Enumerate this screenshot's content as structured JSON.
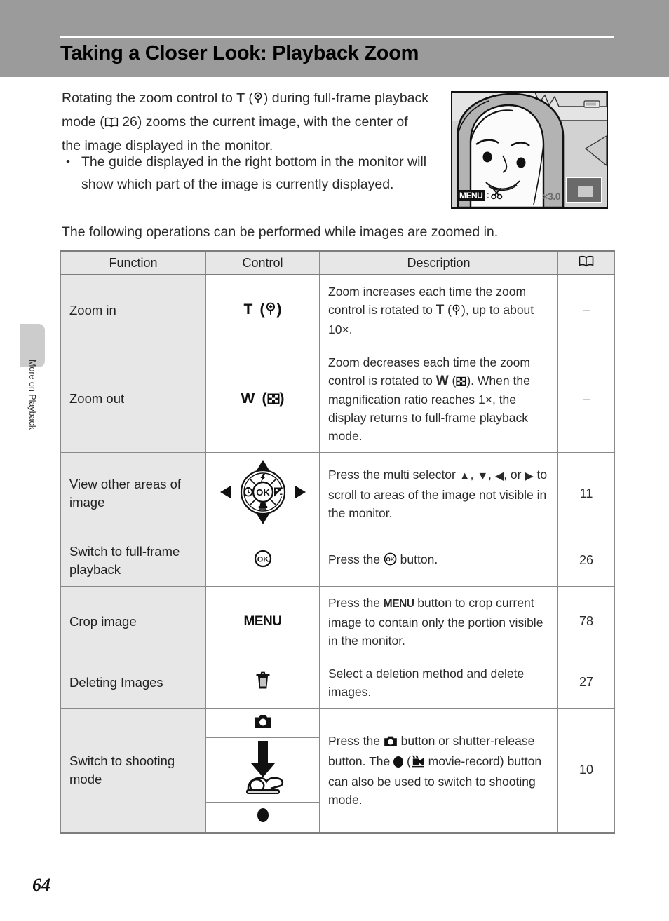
{
  "header": {
    "title": "Taking a Closer Look: Playback Zoom",
    "band_color": "#9b9b9b"
  },
  "side_tab": {
    "label": "More on Playback",
    "block_color": "#cccccc"
  },
  "body": {
    "intro_part1": "Rotating the zoom control to ",
    "intro_T": "T",
    "intro_part2": ") during full-frame playback mode (",
    "intro_page_ref": "26",
    "intro_part3": ") zooms the current image, with the center of the image displayed in the monitor.",
    "bullet1": "The guide displayed in the right bottom in the monitor will show which part of the image is currently displayed.",
    "lead_in": "The following operations can be performed while images are zoomed in."
  },
  "monitor": {
    "menu_label": "MENU",
    "crop_icon": "scissors-icon",
    "magnification": "3.0",
    "magnification_prefix": "×",
    "guide_box": "zoom-guide-indicator",
    "battery_icon": "battery-icon"
  },
  "table": {
    "headers": {
      "function": "Function",
      "control": "Control",
      "description": "Description",
      "page": "book-icon"
    },
    "rows": [
      {
        "function": "Zoom in",
        "control_type": "T-zoom",
        "control_letter": "T",
        "control_icon": "magnify-plus-icon",
        "desc_a": "Zoom increases each time the zoom control is rotated to ",
        "desc_T": "T",
        "desc_b": "), up to about 10",
        "desc_c": ".",
        "page": "–"
      },
      {
        "function": "Zoom out",
        "control_type": "W-zoom",
        "control_letter": "W",
        "control_icon": "thumbnail-grid-icon",
        "desc_a": "Zoom decreases each time the zoom control is rotated to ",
        "desc_W": "W",
        "desc_b": "). When the magnification ratio reaches 1",
        "desc_c": ", the display returns to full-frame playback mode.",
        "page": "–"
      },
      {
        "function": "View other areas of image",
        "control_type": "multi-selector",
        "control_icon": "multi-selector-dial-icon",
        "desc_a": "Press the multi selector ",
        "desc_b": ", ",
        "desc_c": ", ",
        "desc_d": ", or ",
        "desc_e": " to scroll to areas of the image not visible in the monitor.",
        "page": "11"
      },
      {
        "function": "Switch to full-frame playback",
        "control_type": "ok-button",
        "control_icon": "ok-button-icon",
        "desc_a": "Press the ",
        "desc_b": " button.",
        "page": "26"
      },
      {
        "function": "Crop image",
        "control_type": "menu-button",
        "control_label": "MENU",
        "desc_a": "Press the ",
        "desc_menu": "MENU",
        "desc_b": " button to crop current image to contain only the portion visible in the monitor.",
        "page": "78"
      },
      {
        "function": "Deleting Images",
        "control_type": "delete-button",
        "control_icon": "trash-icon",
        "desc_a": "Select a deletion method and delete images.",
        "page": "27"
      },
      {
        "function": "Switch to shooting mode",
        "control_type": "shooting-group",
        "control_icons": [
          "camera-icon",
          "shutter-press-icon",
          "movie-record-dot-icon"
        ],
        "desc_a": "Press the ",
        "desc_b": " button or shutter-release button. The ",
        "desc_c": " (",
        "desc_d": " movie-record) button can also be used to switch to shooting mode.",
        "page": "10"
      }
    ]
  },
  "footer": {
    "page_number": "64"
  }
}
